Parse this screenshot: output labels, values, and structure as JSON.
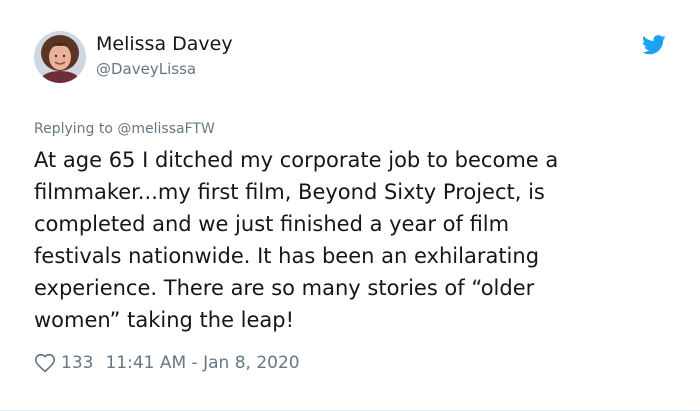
{
  "user": {
    "display_name": "Melissa Davey",
    "handle": "@DaveyLissa"
  },
  "reply": {
    "prefix": "Replying to",
    "target": "@melissaFTW"
  },
  "tweet": {
    "lines": [
      "At age 65 I ditched my corporate job to become a",
      "filmmaker...my first film, Beyond Sixty Project, is",
      "completed and we just finished a year of film",
      "festivals nationwide. It has been an exhilarating",
      "experience. There are so many stories of “older",
      "women” taking the leap!"
    ]
  },
  "footer": {
    "likes": "133",
    "timestamp": "11:41 AM - Jan 8, 2020"
  },
  "icons": {
    "brand": "twitter-bird-icon",
    "like": "heart-icon"
  },
  "colors": {
    "brand": "#1da1f2",
    "text": "#14171a",
    "secondary": "#657786"
  }
}
